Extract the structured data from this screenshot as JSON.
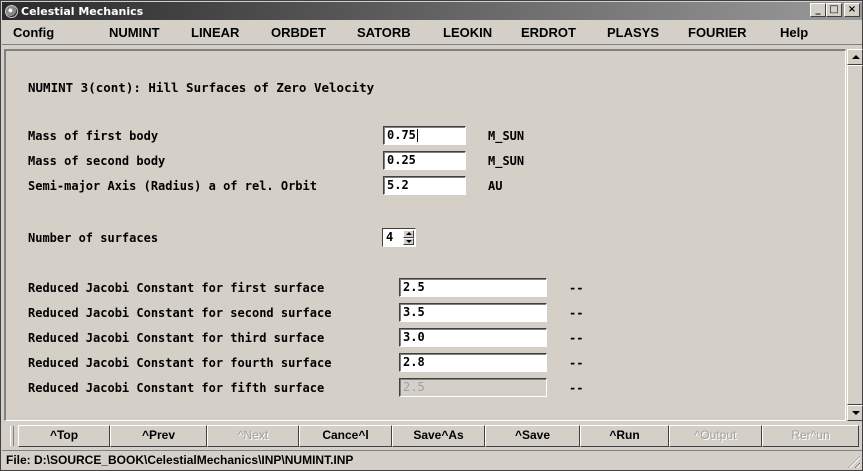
{
  "window": {
    "title": "Celestial Mechanics",
    "minimize_label": "_",
    "maximize_label": "□",
    "close_label": "×"
  },
  "menu": [
    {
      "label": "Config"
    },
    {
      "label": "NUMINT"
    },
    {
      "label": "LINEAR"
    },
    {
      "label": "ORBDET"
    },
    {
      "label": "SATORB"
    },
    {
      "label": "LEOKIN"
    },
    {
      "label": "ERDROT"
    },
    {
      "label": "PLASYS"
    },
    {
      "label": "FOURIER"
    },
    {
      "label": "Help"
    }
  ],
  "form": {
    "section_title": "NUMINT 3(cont): Hill Surfaces of Zero Velocity",
    "mass1": {
      "label": "Mass of first body",
      "value": "0.75",
      "unit": "M_SUN"
    },
    "mass2": {
      "label": "Mass of second body",
      "value": "0.25",
      "unit": "M_SUN"
    },
    "semi_major": {
      "label": "Semi-major Axis (Radius) a of rel. Orbit",
      "value": "5.2",
      "unit": "AU"
    },
    "num_surfaces": {
      "label": "Number of surfaces",
      "value": "4"
    },
    "jacobi": [
      {
        "label": "Reduced Jacobi Constant for first surface",
        "value": "2.5",
        "unit": "--",
        "enabled": true
      },
      {
        "label": "Reduced Jacobi Constant for second surface",
        "value": "3.5",
        "unit": "--",
        "enabled": true
      },
      {
        "label": "Reduced Jacobi Constant for third surface",
        "value": "3.0",
        "unit": "--",
        "enabled": true
      },
      {
        "label": "Reduced Jacobi Constant for fourth surface",
        "value": "2.8",
        "unit": "--",
        "enabled": true
      },
      {
        "label": "Reduced Jacobi Constant for fifth surface",
        "value": "2.5",
        "unit": "--",
        "enabled": false
      }
    ]
  },
  "buttons": [
    {
      "label": "^Top",
      "enabled": true
    },
    {
      "label": "^Prev",
      "enabled": true
    },
    {
      "label": "^Next",
      "enabled": false
    },
    {
      "label": "Cance^l",
      "enabled": true
    },
    {
      "label": "Save^As",
      "enabled": true
    },
    {
      "label": "^Save",
      "enabled": true
    },
    {
      "label": "^Run",
      "enabled": true
    },
    {
      "label": "^Output",
      "enabled": false
    },
    {
      "label": "Rer^un",
      "enabled": false
    }
  ],
  "status": {
    "file_path": "File: D:\\SOURCE_BOOK\\CelestialMechanics\\INP\\NUMINT.INP"
  }
}
